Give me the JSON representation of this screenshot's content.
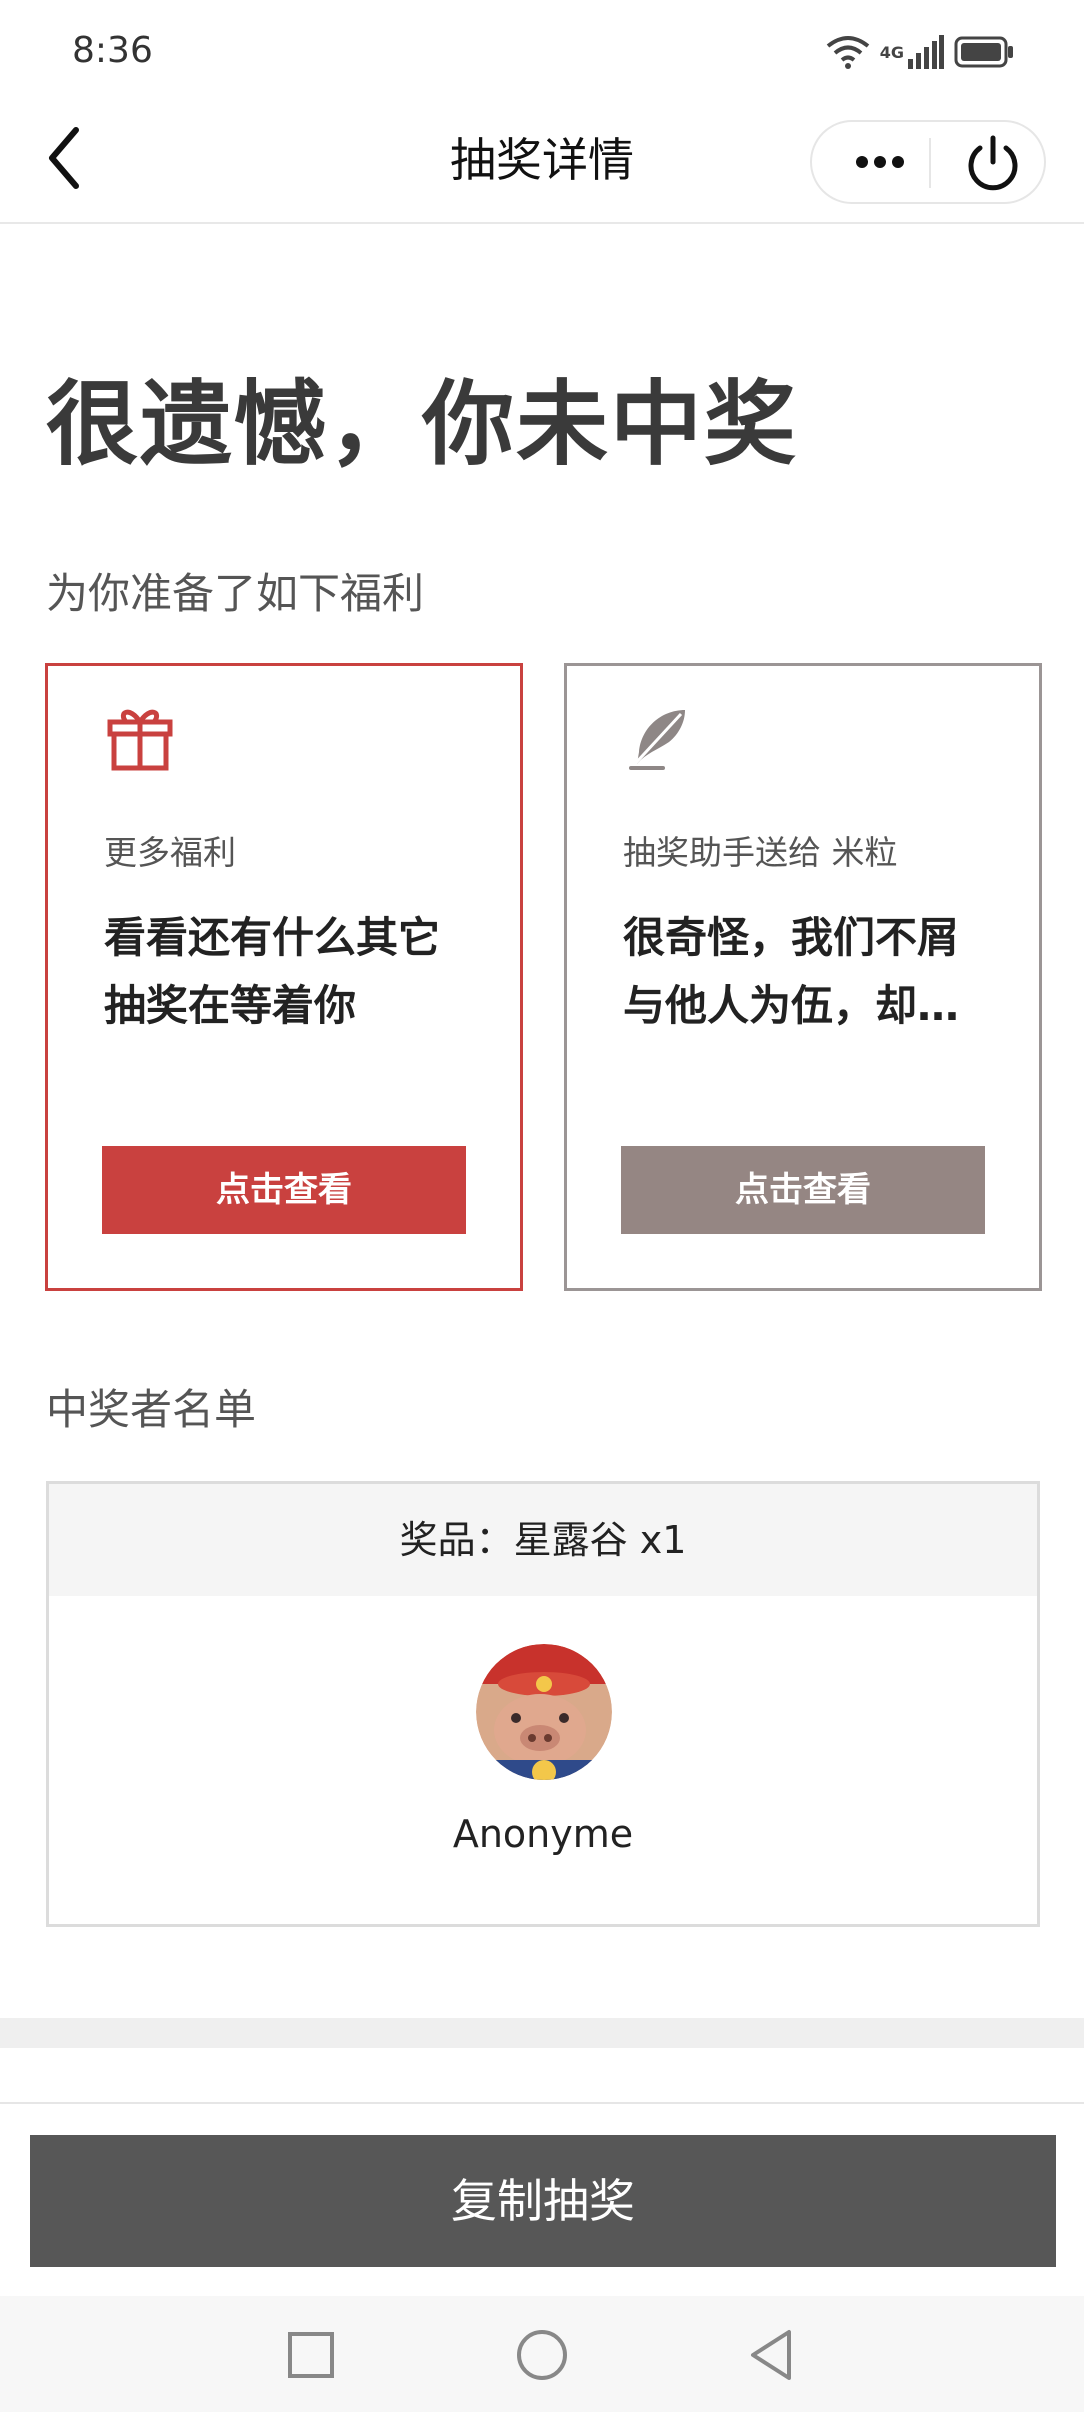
{
  "status_bar": {
    "time": "8:36",
    "network": "4G"
  },
  "nav": {
    "title": "抽奖详情"
  },
  "headline": "很遗憾，你未中奖",
  "benefits_label": "为你准备了如下福利",
  "cards": [
    {
      "subtitle": "更多福利",
      "main": "看看还有什么其它抽奖在等着你",
      "button": "点击查看"
    },
    {
      "subtitle": "抽奖助手送给 米粒",
      "main": "很奇怪，我们不屑与他人为伍，却…",
      "button": "点击查看"
    }
  ],
  "winners": {
    "label": "中奖者名单",
    "prize": "奖品：星露谷 x1",
    "name": "Anonyme"
  },
  "copy_button": "复制抽奖",
  "colors": {
    "accent_red": "#c9413f",
    "muted_brown": "#958683",
    "dark_button": "#575757"
  }
}
